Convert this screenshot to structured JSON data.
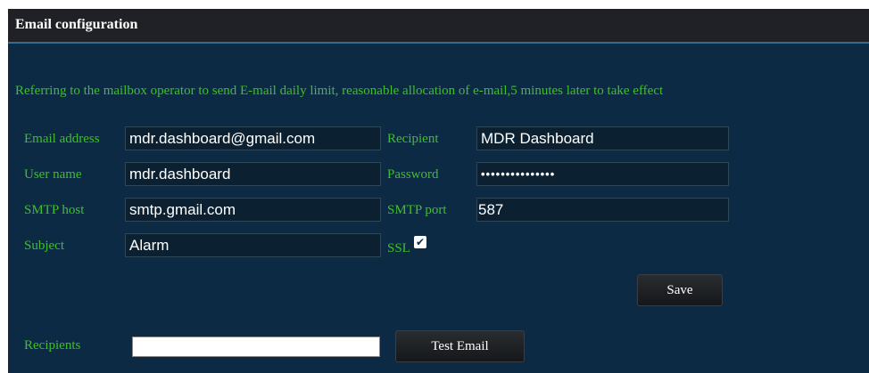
{
  "title": "Email configuration",
  "notice": "Referring to the mailbox operator to send E-mail daily limit, reasonable allocation of e-mail,5 minutes later to take effect",
  "form": {
    "email_label": "Email address",
    "email_value": "mdr.dashboard@gmail.com",
    "recipient_label": "Recipient",
    "recipient_value": "MDR Dashboard",
    "username_label": "User name",
    "username_value": "mdr.dashboard",
    "password_label": "Password",
    "password_value": "•••••••••••••••",
    "smtp_host_label": "SMTP host",
    "smtp_host_value": "smtp.gmail.com",
    "smtp_port_label": "SMTP port",
    "smtp_port_value": "587",
    "subject_label": "Subject",
    "subject_value": "Alarm",
    "ssl_label": "SSL",
    "ssl_checked": true,
    "ssl_check_glyph": "✔"
  },
  "save_label": "Save",
  "recipients_label": "Recipients",
  "recipients_value": "",
  "test_email_label": "Test Email",
  "colors": {
    "panel_bg": "#0d2a44",
    "title_bg": "#1f2126",
    "label_green": "#3fbf2a",
    "field_bg": "#0b2132"
  }
}
